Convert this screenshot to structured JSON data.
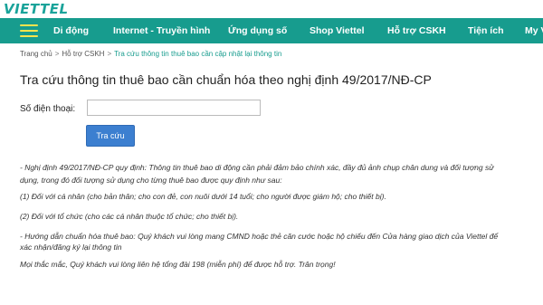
{
  "header": {
    "logo_text": "VIETTEL"
  },
  "nav": {
    "items": [
      {
        "label": "Di động"
      },
      {
        "label": "Internet - Truyền hình"
      },
      {
        "label": "Ứng dụng số"
      },
      {
        "label": "Shop Viettel"
      },
      {
        "label": "Hỗ trợ CSKH"
      },
      {
        "label": "Tiện ích"
      },
      {
        "label": "My V"
      }
    ],
    "bg_color": "#179c8e",
    "menu_icon_color": "#ffe44d"
  },
  "breadcrumb": {
    "home": "Trang chủ",
    "support": "Hỗ trợ CSKH",
    "current": "Tra cứu thông tin thuê bao cần cập nhật lại thông tin"
  },
  "page": {
    "title": "Tra cứu thông tin thuê bao cần chuẩn hóa theo nghị định 49/2017/NĐ-CP",
    "phone_label": "Số điện thoại:",
    "phone_value": "",
    "search_button": "Tra cứu",
    "button_color": "#3c7fd0"
  },
  "content": {
    "line1": "- Nghị định 49/2017/NĐ-CP quy định: Thông tin thuê bao di động cần phải đảm bảo chính xác, đầy đủ ảnh chụp chân dung và đối tượng sử",
    "line2": "dụng, trong đó đối tượng sử dụng cho từng thuê bao được quy định như sau:",
    "line3": "(1) Đối với cá nhân (cho bản thân; cho con đẻ, con nuôi dưới 14 tuổi; cho người được giám hộ; cho thiết bị).",
    "line4": "(2) Đối với tổ chức (cho các cá nhân thuộc tổ chức; cho thiết bị).",
    "line5": "- Hướng dẫn chuẩn hóa thuê bao: Quý khách vui lòng mang CMND hoặc thẻ căn cước hoặc hộ chiếu đến Cửa hàng giao dịch của Viettel để",
    "line6": "xác nhận/đăng ký lại thông tin",
    "line7": "Mọi thắc mắc, Quý khách vui lòng liên hệ tổng đài 198 (miễn phí) để được hỗ trợ. Trân trọng!"
  }
}
